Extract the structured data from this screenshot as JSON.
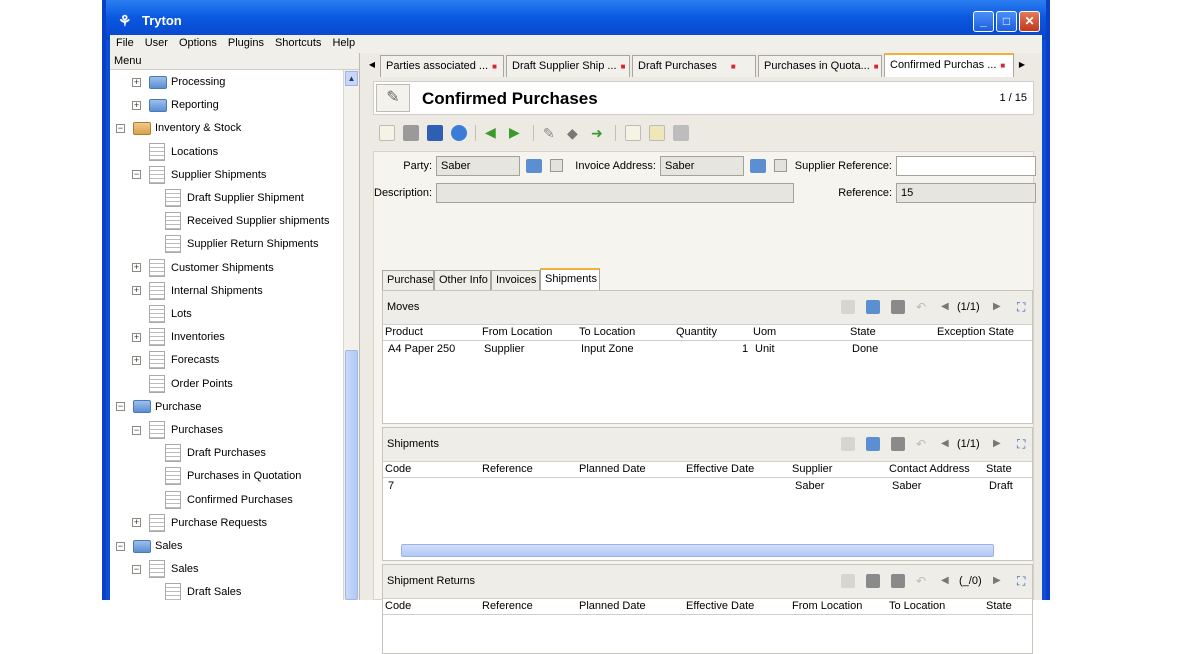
{
  "window": {
    "title": "Tryton"
  },
  "menubar": [
    "File",
    "User",
    "Options",
    "Plugins",
    "Shortcuts",
    "Help"
  ],
  "sidebar": {
    "header": "Menu",
    "items": [
      {
        "label": "Processing",
        "level": 1,
        "icon": "folder-icon",
        "expander": "+"
      },
      {
        "label": "Reporting",
        "level": 1,
        "icon": "folder-icon",
        "expander": "+"
      },
      {
        "label": "Inventory & Stock",
        "level": 0,
        "icon": "box-icon",
        "expander": "−"
      },
      {
        "label": "Locations",
        "level": 1,
        "icon": "document-icon",
        "expander": ""
      },
      {
        "label": "Supplier Shipments",
        "level": 1,
        "icon": "document-icon",
        "expander": "−"
      },
      {
        "label": "Draft Supplier Shipment",
        "level": 2,
        "icon": "document-icon",
        "expander": ""
      },
      {
        "label": "Received Supplier shipments",
        "level": 2,
        "icon": "document-icon",
        "expander": ""
      },
      {
        "label": "Supplier Return Shipments",
        "level": 2,
        "icon": "document-icon",
        "expander": ""
      },
      {
        "label": "Customer Shipments",
        "level": 1,
        "icon": "document-icon",
        "expander": "+"
      },
      {
        "label": "Internal Shipments",
        "level": 1,
        "icon": "document-icon",
        "expander": "+"
      },
      {
        "label": "Lots",
        "level": 1,
        "icon": "document-icon",
        "expander": ""
      },
      {
        "label": "Inventories",
        "level": 1,
        "icon": "document-icon",
        "expander": "+"
      },
      {
        "label": "Forecasts",
        "level": 1,
        "icon": "document-icon",
        "expander": "+"
      },
      {
        "label": "Order Points",
        "level": 1,
        "icon": "document-icon",
        "expander": ""
      },
      {
        "label": "Purchase",
        "level": 0,
        "icon": "folder-icon",
        "expander": "−"
      },
      {
        "label": "Purchases",
        "level": 1,
        "icon": "document-icon",
        "expander": "−"
      },
      {
        "label": "Draft Purchases",
        "level": 2,
        "icon": "document-icon",
        "expander": ""
      },
      {
        "label": "Purchases in Quotation",
        "level": 2,
        "icon": "document-icon",
        "expander": ""
      },
      {
        "label": "Confirmed Purchases",
        "level": 2,
        "icon": "document-icon",
        "expander": ""
      },
      {
        "label": "Purchase Requests",
        "level": 1,
        "icon": "document-icon",
        "expander": "+"
      },
      {
        "label": "Sales",
        "level": 0,
        "icon": "folder-icon",
        "expander": "−"
      },
      {
        "label": "Sales",
        "level": 1,
        "icon": "document-icon",
        "expander": "−"
      },
      {
        "label": "Draft Sales",
        "level": 2,
        "icon": "document-icon",
        "expander": ""
      }
    ]
  },
  "tabs": [
    {
      "label": "Parties associated ...",
      "active": false
    },
    {
      "label": "Draft Supplier Ship ...",
      "active": false
    },
    {
      "label": "Draft Purchases",
      "active": false
    },
    {
      "label": "Purchases in Quota...",
      "active": false
    },
    {
      "label": "Confirmed Purchas ...",
      "active": true
    }
  ],
  "form": {
    "title": "Confirmed Purchases",
    "record_count": "1 / 15",
    "party_label": "Party:",
    "party_value": "Saber",
    "invoice_address_label": "Invoice Address:",
    "invoice_address_value": "Saber",
    "supplier_reference_label": "Supplier Reference:",
    "supplier_reference_value": "",
    "description_label": "Description:",
    "description_value": "",
    "reference_label": "Reference:",
    "reference_value": "15"
  },
  "inner_tabs": [
    "Purchase",
    "Other Info",
    "Invoices",
    "Shipments"
  ],
  "moves": {
    "title": "Moves",
    "nav": "(1/1)",
    "columns": [
      "Product",
      "From Location",
      "To Location",
      "Quantity",
      "Uom",
      "State",
      "Exception State"
    ],
    "rows": [
      [
        "A4 Paper 250",
        "Supplier",
        "Input Zone",
        "1",
        "Unit",
        "Done",
        ""
      ]
    ]
  },
  "shipments": {
    "title": "Shipments",
    "nav": "(1/1)",
    "columns": [
      "Code",
      "Reference",
      "Planned Date",
      "Effective Date",
      "Supplier",
      "Contact Address",
      "State"
    ],
    "rows": [
      [
        "7",
        "",
        "",
        "",
        "Saber",
        "Saber",
        "Draft"
      ]
    ]
  },
  "shipment_returns": {
    "title": "Shipment Returns",
    "nav": "(_/0)",
    "columns": [
      "Code",
      "Reference",
      "Planned Date",
      "Effective Date",
      "From Location",
      "To Location",
      "State"
    ]
  }
}
